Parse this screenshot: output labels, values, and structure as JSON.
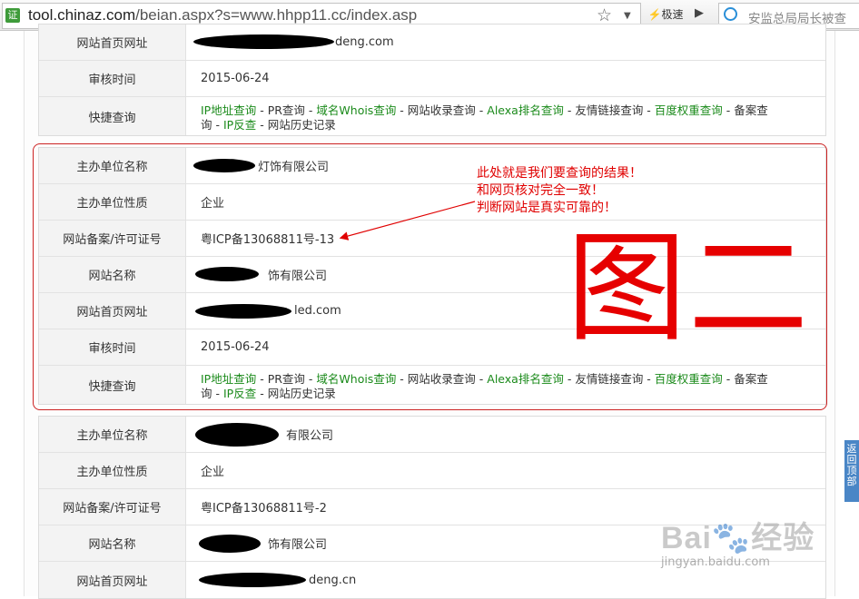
{
  "browser": {
    "url_host": "tool.chinaz.com",
    "url_rest": "/beian.aspx?s=www.hhpp11.cc/index.asp",
    "speed_label": "极速",
    "search_text": "安监总局局长被查",
    "favicon_char": "证"
  },
  "card_top": {
    "rows": [
      {
        "label": "网站首页网址",
        "value": "deng.com"
      },
      {
        "label": "审核时间",
        "value": "2015-06-24"
      },
      {
        "label": "快捷查询"
      }
    ]
  },
  "card_mid": {
    "rows": [
      {
        "label": "主办单位名称",
        "value": "灯饰有限公司"
      },
      {
        "label": "主办单位性质",
        "value": "企业"
      },
      {
        "label": "网站备案/许可证号",
        "value": "粤ICP备13068811号-13"
      },
      {
        "label": "网站名称",
        "value": "饰有限公司"
      },
      {
        "label": "网站首页网址",
        "value": "led.com"
      },
      {
        "label": "审核时间",
        "value": "2015-06-24"
      },
      {
        "label": "快捷查询"
      }
    ]
  },
  "card_bottom": {
    "rows": [
      {
        "label": "主办单位名称",
        "value": "有限公司"
      },
      {
        "label": "主办单位性质",
        "value": "企业"
      },
      {
        "label": "网站备案/许可证号",
        "value": "粤ICP备13068811号-2"
      },
      {
        "label": "网站名称",
        "value": "饰有限公司"
      },
      {
        "label": "网站首页网址",
        "value": "deng.cn"
      }
    ]
  },
  "quick_links": {
    "ip": "IP地址查询",
    "pr": "PR查询",
    "whois": "域名Whois查询",
    "index": "网站收录查询",
    "alexa": "Alexa排名查询",
    "friend": "友情链接查询",
    "baidu": "百度权重查询",
    "beian_a": "备案查",
    "beian_b": "询",
    "reverse": "IP反查",
    "history": "网站历史记录"
  },
  "annotation": {
    "line1": "此处就是我们要查询的结果！",
    "line2": "和网页核对完全一致！",
    "line3": "判断网站是真实可靠的！",
    "char1": "图",
    "char2": "二"
  },
  "back_to_top": "返回顶部",
  "watermark": {
    "main": "Bai",
    "paw": "🐾",
    "tail": "经验",
    "sub": "jingyan.baidu.com"
  },
  "colors": {
    "link_green": "#1a8a1a",
    "annotation_red": "#e00000",
    "highlight_border": "#cc2222"
  }
}
